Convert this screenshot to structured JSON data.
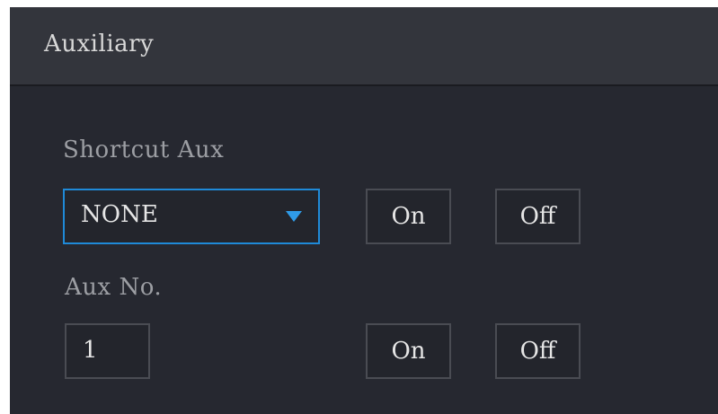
{
  "header": {
    "title": "Auxiliary"
  },
  "shortcut_aux": {
    "label": "Shortcut Aux",
    "selected_value": "NONE",
    "on_label": "On",
    "off_label": "Off"
  },
  "aux_no": {
    "label": "Aux No.",
    "value": "1",
    "on_label": "On",
    "off_label": "Off"
  },
  "colors": {
    "panel_bg": "#262830",
    "header_bg": "#33353c",
    "accent": "#1f8ad8",
    "text": "#e6e6e6",
    "label_text": "#9c9ea3"
  }
}
